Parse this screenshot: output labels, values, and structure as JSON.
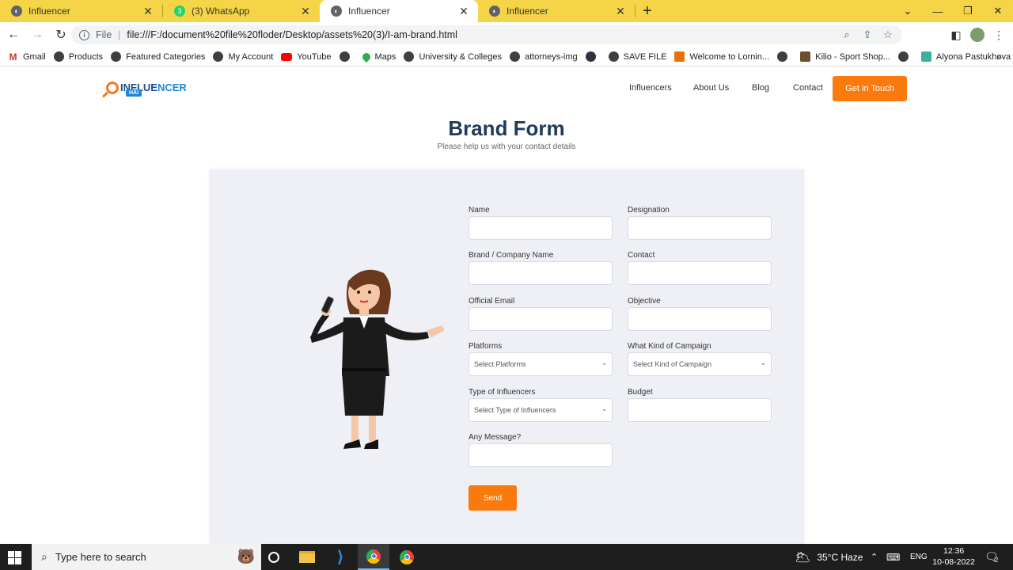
{
  "browser": {
    "tabs": [
      {
        "title": "Influencer",
        "icon": "globe-icon",
        "active": false
      },
      {
        "title": "(3) WhatsApp",
        "icon": "whatsapp-icon",
        "active": false
      },
      {
        "title": "Influencer",
        "icon": "globe-icon",
        "active": true
      },
      {
        "title": "Influencer",
        "icon": "globe-icon",
        "active": false
      }
    ],
    "new_tab": "+",
    "url_scheme": "File",
    "url": "file:///F:/document%20file%20floder/Desktop/assets%20(3)/I-am-brand.html",
    "bookmarks": [
      {
        "label": "Gmail",
        "icon": "gmail-icon"
      },
      {
        "label": "Products",
        "icon": "globe-icon"
      },
      {
        "label": "Featured Categories",
        "icon": "globe-icon"
      },
      {
        "label": "My Account",
        "icon": "globe-icon"
      },
      {
        "label": "YouTube",
        "icon": "youtube-icon"
      },
      {
        "label": "",
        "icon": "globe-icon"
      },
      {
        "label": "Maps",
        "icon": "maps-icon"
      },
      {
        "label": "University & Colleges",
        "icon": "globe-icon"
      },
      {
        "label": "attorneys-img",
        "icon": "globe-icon"
      },
      {
        "label": "",
        "icon": "app-icon"
      },
      {
        "label": "SAVE FILE",
        "icon": "globe-icon"
      },
      {
        "label": "Welcome to Lornin...",
        "icon": "site-icon"
      },
      {
        "label": "",
        "icon": "globe-icon"
      },
      {
        "label": "Kilio - Sport Shop...",
        "icon": "site-icon"
      },
      {
        "label": "",
        "icon": "globe-icon"
      },
      {
        "label": "Alyona Pastukhova",
        "icon": "site-icon"
      }
    ],
    "bookmarks_more": "»"
  },
  "site": {
    "logo_line1_a": "INFLUE",
    "logo_line1_b": "NCER",
    "logo_line2": "HAI",
    "nav": [
      "Influencers",
      "About Us",
      "Blog",
      "Contact"
    ],
    "cta": "Get in Touch"
  },
  "form": {
    "title": "Brand Form",
    "subtitle": "Please help us with your contact details",
    "fields": {
      "name": {
        "label": "Name",
        "value": ""
      },
      "designation": {
        "label": "Designation",
        "value": ""
      },
      "company": {
        "label": "Brand / Company Name",
        "value": ""
      },
      "contact": {
        "label": "Contact",
        "value": ""
      },
      "email": {
        "label": "Official Email",
        "value": ""
      },
      "objective": {
        "label": "Objective",
        "value": ""
      },
      "platforms": {
        "label": "Platforms",
        "selected": "Select Platforms"
      },
      "campaign": {
        "label": "What Kind of Campaign",
        "selected": "Select Kind of Campaign"
      },
      "influencer_type": {
        "label": "Type of Influencers",
        "selected": "Select Type of Influencers"
      },
      "budget": {
        "label": "Budget",
        "value": ""
      },
      "message": {
        "label": "Any Message?",
        "value": ""
      }
    },
    "submit": "Send"
  },
  "taskbar": {
    "search_placeholder": "Type here to search",
    "weather": "35°C  Haze",
    "language": "ENG",
    "time": "12:36",
    "date": "10-08-2022",
    "notification_count": "2"
  }
}
